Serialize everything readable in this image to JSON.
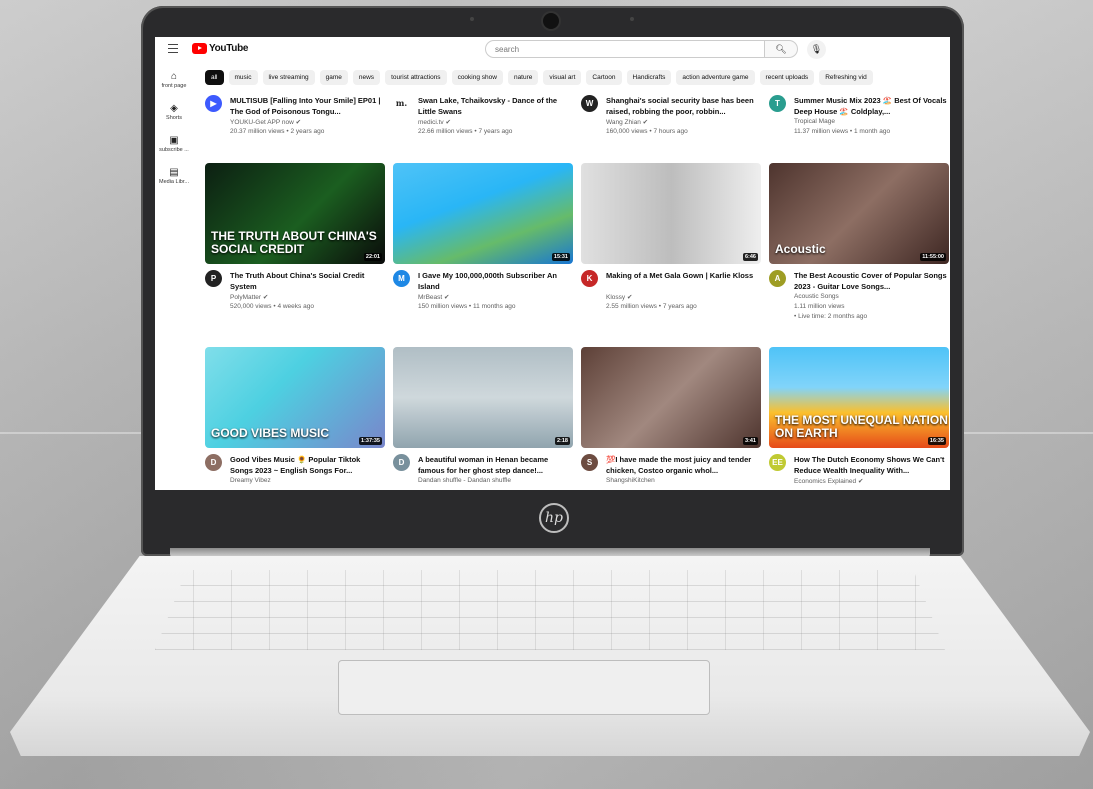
{
  "app": {
    "name": "YouTube"
  },
  "search": {
    "placeholder": "search"
  },
  "sidebar": {
    "items": [
      {
        "label": "front page",
        "icon": "home-icon"
      },
      {
        "label": "Shorts",
        "icon": "shorts-icon"
      },
      {
        "label": "subscribe ...",
        "icon": "subscriptions-icon"
      },
      {
        "label": "Media Libr...",
        "icon": "library-icon"
      }
    ]
  },
  "chips": [
    "all",
    "music",
    "live streaming",
    "game",
    "news",
    "tourist attractions",
    "cooking show",
    "nature",
    "visual art",
    "Cartoon",
    "Handicrafts",
    "action adventure game",
    "recent uploads",
    "Refreshing vid"
  ],
  "rows": [
    [
      {
        "title": "MULTISUB [Falling Into Your Smile] EP01 | The God of Poisonous Tongu...",
        "channel": "YOUKU-Get APP now ✔",
        "stats": "20.37 million views • 2 years ago",
        "avatar": "▶",
        "avatar_color": "#3d5afe"
      },
      {
        "title": "Swan Lake, Tchaikovsky - Dance of the Little Swans",
        "channel": "medici.tv ✔",
        "stats": "22.66 million views • 7 years ago",
        "avatar": "m.",
        "avatar_color": "#ffffff"
      },
      {
        "title": "Shanghai's social security base has been raised, robbing the poor, robbin...",
        "channel": "Wang Zhian ✔",
        "stats": "160,000 views • 7 hours ago",
        "avatar": "W",
        "avatar_color": "#222222"
      },
      {
        "title": "Summer Music Mix 2023 🏖️ Best Of Vocals Deep House 🏖️ Coldplay,...",
        "channel": "Tropical Mage",
        "stats": "11.37 million views • 1 month ago",
        "avatar": "T",
        "avatar_color": "#2a9d8f"
      }
    ],
    [
      {
        "title": "The Truth About China's Social Credit System",
        "channel": "PolyMatter ✔",
        "stats": "520,000 views • 4 weeks ago",
        "extra": "",
        "duration": "22:01",
        "thumb_text": "THE TRUTH ABOUT CHINA'S SOCIAL CREDIT",
        "avatar": "P",
        "avatar_color": "#222222",
        "thumb_bg": "linear-gradient(135deg,#0c1f12,#1b5e20 55%,#0a0a0a)"
      },
      {
        "title": "I Gave My 100,000,000th Subscriber An Island",
        "channel": "MrBeast ✔",
        "stats": "150 million views • 11 months ago",
        "extra": "",
        "duration": "15:31",
        "thumb_text": "",
        "avatar": "M",
        "avatar_color": "#1e88e5",
        "thumb_bg": "linear-gradient(160deg,#4fc3f7,#29b6f6 40%,#66bb6a 70%,#1976d2)"
      },
      {
        "title": "Making of a Met Gala Gown | Karlie Kloss",
        "channel": "Klossy ✔",
        "stats": "2.55 million views • 7 years ago",
        "extra": "",
        "duration": "6:46",
        "thumb_text": "",
        "avatar": "K",
        "avatar_color": "#c62828",
        "thumb_bg": "linear-gradient(90deg,#e0e0e0,#bdbdbd 50%,#eeeeee)"
      },
      {
        "title": "The Best Acoustic Cover of Popular Songs 2023 - Guitar Love Songs...",
        "channel": "Acoustic Songs",
        "stats": "1.11 million views",
        "extra": "• Live time: 2 months ago",
        "duration": "11:55:00",
        "thumb_text": "Acoustic",
        "avatar": "A",
        "avatar_color": "#9e9d24",
        "thumb_bg": "linear-gradient(135deg,#4e342e,#8d6e63 50%,#3e2723)"
      }
    ],
    [
      {
        "title": "Good Vibes Music 🌻 Popular Tiktok Songs 2023 ~ English Songs For...",
        "channel": "Dreamy Vibez",
        "stats": "",
        "duration": "1:37:35",
        "thumb_text": "GOOD VIBES MUSIC",
        "avatar": "D",
        "avatar_color": "#8d6e63",
        "thumb_bg": "linear-gradient(135deg,#80deea,#4dd0e1 40%,#7986cb)"
      },
      {
        "title": "A beautiful woman in Henan became famous for her ghost step dance!...",
        "channel": "Dandan shuffle - Dandan shuffle",
        "stats": "",
        "duration": "2:18",
        "thumb_text": "",
        "avatar": "D",
        "avatar_color": "#78909c",
        "thumb_bg": "linear-gradient(180deg,#b0bec5,#cfd8dc 50%,#90a4ae)"
      },
      {
        "title": "💯I have made the most juicy and tender chicken, Costco organic whol...",
        "channel": "ShangshiKitchen",
        "stats": "",
        "duration": "3:41",
        "thumb_text": "",
        "avatar": "S",
        "avatar_color": "#6d4c41",
        "thumb_bg": "linear-gradient(135deg,#5d4037,#a1887f 50%,#4e342e)"
      },
      {
        "title": "How The Dutch Economy Shows We Can't Reduce Wealth Inequality With...",
        "channel": "Economics Explained ✔",
        "stats": "",
        "duration": "16:35",
        "thumb_text": "THE MOST UNEQUAL NATION ON EARTH",
        "avatar": "EE",
        "avatar_color": "#c0ca33",
        "thumb_bg": "linear-gradient(180deg,#4fc3f7,#81d4fa 40%,#fbc02d 65%,#e64a19)"
      }
    ]
  ],
  "device": {
    "logo": "hp"
  }
}
